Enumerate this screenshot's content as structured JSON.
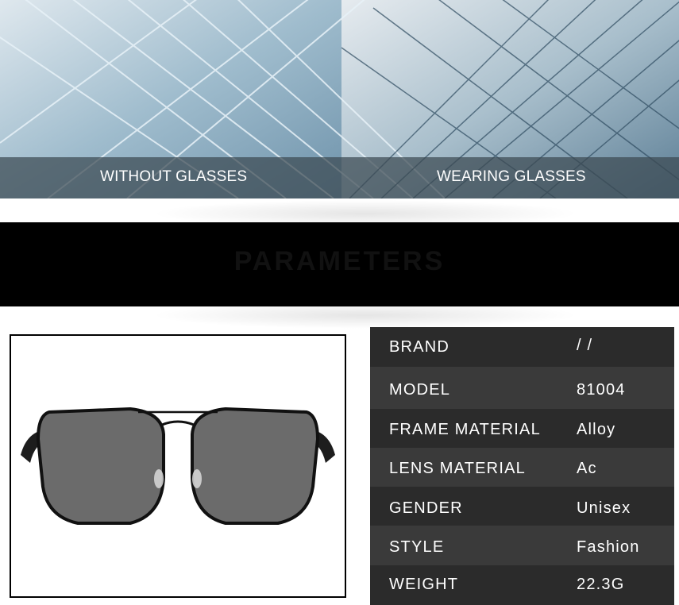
{
  "banner": {
    "left_label": "WITHOUT GLASSES",
    "right_label": "WEARING GLASSES"
  },
  "header_bar": {
    "title": "PARAMETERS"
  },
  "product": {
    "image_icon": "sunglasses-icon"
  },
  "specs": [
    {
      "label": "BRAND",
      "value": "/ /"
    },
    {
      "label": "MODEL",
      "value": "81004"
    },
    {
      "label": "FRAME MATERIAL",
      "value": "Alloy"
    },
    {
      "label": "LENS MATERIAL",
      "value": "Ac"
    },
    {
      "label": "GENDER",
      "value": "Unisex"
    },
    {
      "label": "STYLE",
      "value": "Fashion"
    },
    {
      "label": "WEIGHT",
      "value": "22.3G"
    }
  ],
  "colors": {
    "bar": "#000000",
    "table_dark": "#2b2b2b",
    "table_light": "#3a3a3a",
    "text": "#ffffff"
  }
}
